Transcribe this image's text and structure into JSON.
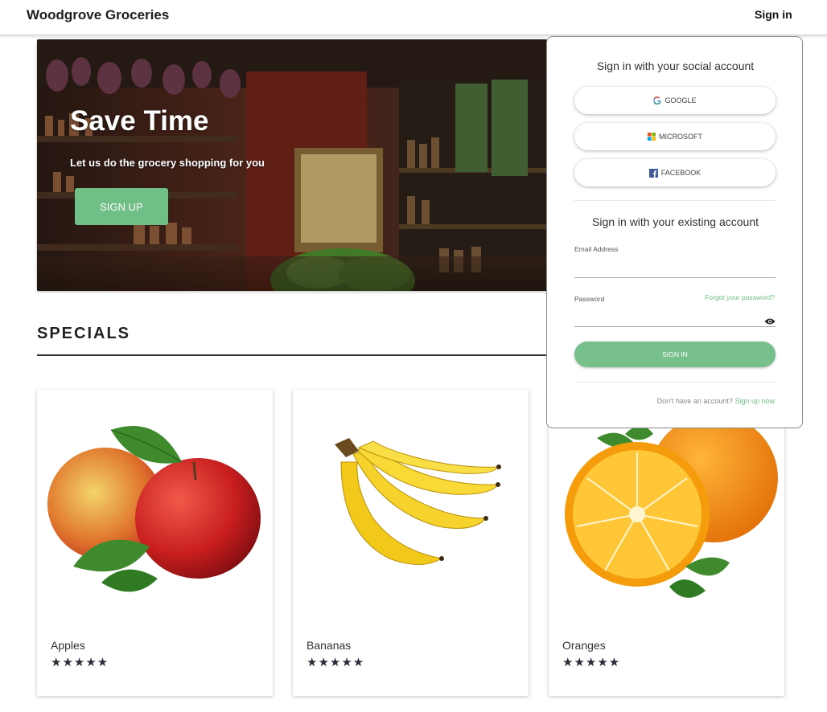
{
  "header": {
    "brand": "Woodgrove Groceries",
    "signin_label": "Sign in"
  },
  "hero": {
    "title": "Save Time",
    "subtitle": "Let us do the grocery shopping for you",
    "signup_label": "SIGN UP"
  },
  "specials": {
    "title": "SPECIALS",
    "items": [
      {
        "name": "Apples",
        "stars": "★★★★★",
        "rating": 5,
        "icon": "apple-image"
      },
      {
        "name": "Bananas",
        "stars": "★★★★★",
        "rating": 5,
        "icon": "banana-image"
      },
      {
        "name": "Oranges",
        "stars": "★★★★★",
        "rating": 5,
        "icon": "orange-image"
      }
    ]
  },
  "signin_panel": {
    "social_heading": "Sign in with your social account",
    "google_label": "GOOGLE",
    "microsoft_label": "MICROSOFT",
    "facebook_label": "FACEBOOK",
    "existing_heading": "Sign in with your existing account",
    "email_label": "Email Address",
    "email_value": "",
    "password_label": "Password",
    "password_value": "",
    "forgot_label": "Forgot your password?",
    "signin_button": "SIGN IN",
    "no_account_text": "Don't have an account?",
    "signup_now_label": "Sign up now"
  },
  "colors": {
    "accent_green": "#6fbf86",
    "star": "#2a2a38"
  }
}
